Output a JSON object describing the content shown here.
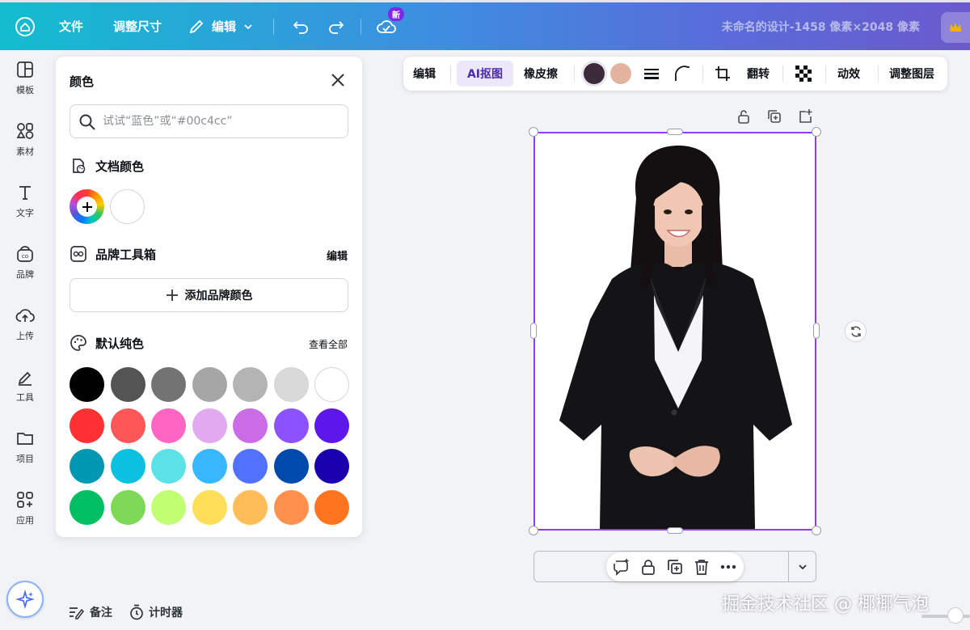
{
  "topbar": {
    "file": "文件",
    "resize": "调整尺寸",
    "edit": "编辑",
    "new_badge": "新",
    "doc_title": "未命名的设计-1458 像素×2048 像素"
  },
  "rail": {
    "items": [
      {
        "label": "模板",
        "icon": "template-icon"
      },
      {
        "label": "素材",
        "icon": "elements-icon"
      },
      {
        "label": "文字",
        "icon": "text-icon"
      },
      {
        "label": "品牌",
        "icon": "brand-icon"
      },
      {
        "label": "上传",
        "icon": "upload-icon"
      },
      {
        "label": "工具",
        "icon": "tools-icon"
      },
      {
        "label": "项目",
        "icon": "folder-icon"
      },
      {
        "label": "应用",
        "icon": "apps-icon"
      }
    ]
  },
  "panel": {
    "title": "颜色",
    "search_placeholder": "试试“蓝色”或“#00c4cc”",
    "doc_colors_title": "文档颜色",
    "brand_kit_title": "品牌工具箱",
    "brand_kit_edit": "编辑",
    "add_brand_color": "添加品牌颜色",
    "default_colors_title": "默认纯色",
    "view_all": "查看全部",
    "doc_colors": [
      "#ffffff"
    ],
    "default_colors": [
      [
        "#000000",
        "#545454",
        "#737373",
        "#a6a6a6",
        "#b4b4b4",
        "#d9d9d9",
        "#ffffff"
      ],
      [
        "#ff3131",
        "#ff5757",
        "#ff66c4",
        "#e2a9f1",
        "#cb6ce6",
        "#8c52ff",
        "#5e17eb"
      ],
      [
        "#0097b2",
        "#0cc0df",
        "#5ce1e6",
        "#38b6ff",
        "#5271ff",
        "#004aad",
        "#1800ad"
      ],
      [
        "#00bf63",
        "#7ed957",
        "#c1ff72",
        "#ffde59",
        "#ffbd59",
        "#ff914d",
        "#ff751f"
      ]
    ]
  },
  "ctx": {
    "edit": "编辑",
    "ai_cutout": "AI抠图",
    "eraser": "橡皮擦",
    "color1": "#3b2a3a",
    "color2": "#e2b4a0",
    "flip": "翻转",
    "animate": "动效",
    "layers": "调整图层"
  },
  "bottom": {
    "notes": "备注",
    "timer": "计时器"
  },
  "watermark": "掘金技术社区 @ 椰椰气泡"
}
